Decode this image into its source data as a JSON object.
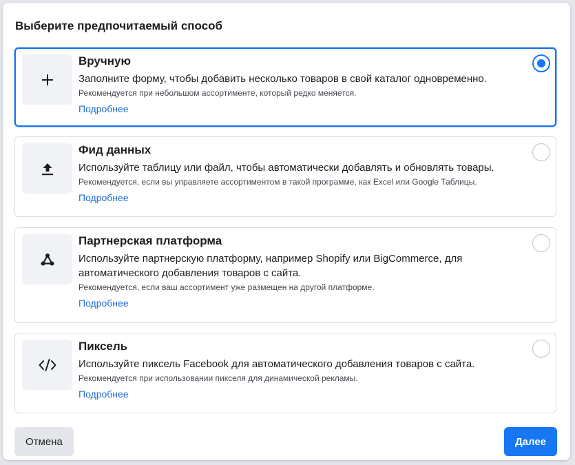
{
  "dialog": {
    "title": "Выберите предпочитаемый способ"
  },
  "options": [
    {
      "icon": "plus-icon",
      "title": "Вручную",
      "description": "Заполните форму, чтобы добавить несколько товаров в свой каталог одновременно.",
      "recommendation": "Рекомендуется при небольшом ассортименте, который редко меняется.",
      "link": "Подробнее",
      "selected": true
    },
    {
      "icon": "upload-icon",
      "title": "Фид данных",
      "description": "Используйте таблицу или файл, чтобы автоматически добавлять и обновлять товары.",
      "recommendation": "Рекомендуется, если вы управляете ассортиментом в такой программе, как Excel или Google Таблицы.",
      "link": "Подробнее",
      "selected": false
    },
    {
      "icon": "partner-platform-icon",
      "title": "Партнерская платформа",
      "description": "Используйте партнерскую платформу, например Shopify или BigCommerce, для автоматического добавления товаров с сайта.",
      "recommendation": "Рекомендуется, если ваш ассортимент уже размещен на другой платформе.",
      "link": "Подробнее",
      "selected": false
    },
    {
      "icon": "code-icon",
      "title": "Пиксель",
      "description": "Используйте пиксель Facebook для автоматического добавления товаров с сайта.",
      "recommendation": "Рекомендуется при использовании пикселя для динамической рекламы.",
      "link": "Подробнее",
      "selected": false
    }
  ],
  "footer": {
    "cancel_label": "Отмена",
    "next_label": "Далее"
  },
  "colors": {
    "accent": "#1877f2",
    "link": "#216fdb",
    "border": "#dadde1",
    "icon_bg": "#f0f2f5"
  }
}
